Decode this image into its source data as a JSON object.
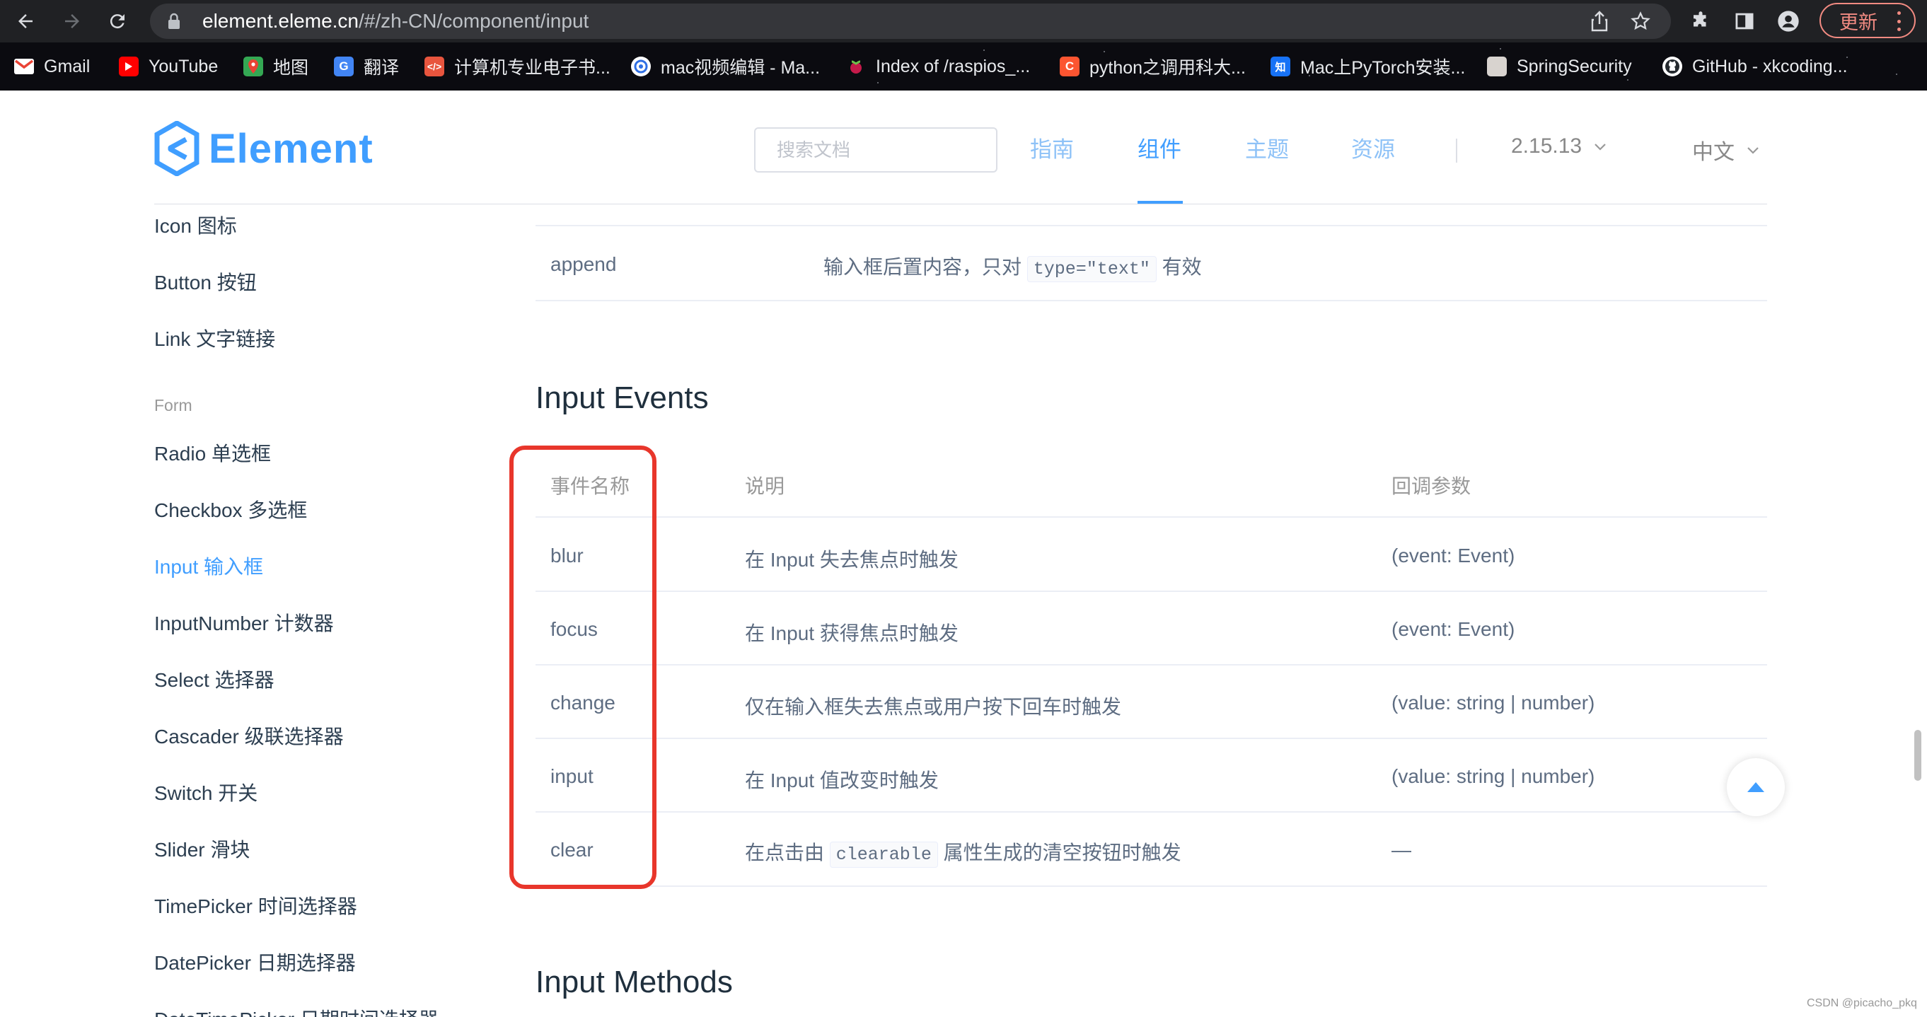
{
  "browser": {
    "url_host": "element.eleme.cn",
    "url_path": "/#/zh-CN/component/input",
    "update_label": "更新",
    "bookmarks": [
      {
        "label": "Gmail",
        "icon": "gmail-icon"
      },
      {
        "label": "YouTube",
        "icon": "youtube-icon"
      },
      {
        "label": "地图",
        "icon": "maps-icon"
      },
      {
        "label": "翻译",
        "icon": "translate-icon"
      },
      {
        "label": "计算机专业电子书...",
        "icon": "code-icon"
      },
      {
        "label": "mac视频编辑 - Ma...",
        "icon": "globe-icon"
      },
      {
        "label": "Index of /raspios_...",
        "icon": "raspberry-icon"
      },
      {
        "label": "python之调用科大...",
        "icon": "csdn-icon"
      },
      {
        "label": "Mac上PyTorch安装...",
        "icon": "zhihu-icon"
      },
      {
        "label": "SpringSecurity",
        "icon": "page-icon"
      },
      {
        "label": "GitHub - xkcoding...",
        "icon": "github-icon"
      }
    ]
  },
  "header": {
    "logo_text": "Element",
    "search_placeholder": "搜索文档",
    "nav": [
      "指南",
      "组件",
      "主题",
      "资源"
    ],
    "active_nav": "组件",
    "version": "2.15.13",
    "language": "中文"
  },
  "sidebar": {
    "items_top": [
      "Icon 图标",
      "Button 按钮",
      "Link 文字链接"
    ],
    "group_label": "Form",
    "items_form": [
      "Radio 单选框",
      "Checkbox 多选框",
      "Input 输入框",
      "InputNumber 计数器",
      "Select 选择器",
      "Cascader 级联选择器",
      "Switch 开关",
      "Slider 滑块",
      "TimePicker 时间选择器",
      "DatePicker 日期选择器",
      "DateTimePicker 日期时间选择器"
    ],
    "active_item": "Input 输入框"
  },
  "attrs_table": {
    "last_row": {
      "name": "append",
      "desc_before": "输入框后置内容，只对",
      "desc_code": "type=\"text\"",
      "desc_after": "有效"
    }
  },
  "events": {
    "title": "Input Events",
    "headers": [
      "事件名称",
      "说明",
      "回调参数"
    ],
    "rows": [
      {
        "name": "blur",
        "desc": "在 Input 失去焦点时触发",
        "params": "(event: Event)"
      },
      {
        "name": "focus",
        "desc": "在 Input 获得焦点时触发",
        "params": "(event: Event)"
      },
      {
        "name": "change",
        "desc": "仅在输入框失去焦点或用户按下回车时触发",
        "params": "(value: string | number)"
      },
      {
        "name": "input",
        "desc": "在 Input 值改变时触发",
        "params": "(value: string | number)"
      },
      {
        "name": "clear",
        "desc_before": "在点击由",
        "desc_code": "clearable",
        "desc_after": "属性生成的清空按钮时触发",
        "params": "—"
      }
    ]
  },
  "methods": {
    "title": "Input Methods"
  },
  "watermark": "CSDN @picacho_pkq",
  "colors": {
    "primary": "#409eff",
    "highlight": "#e8362b",
    "chrome": "#202124"
  }
}
